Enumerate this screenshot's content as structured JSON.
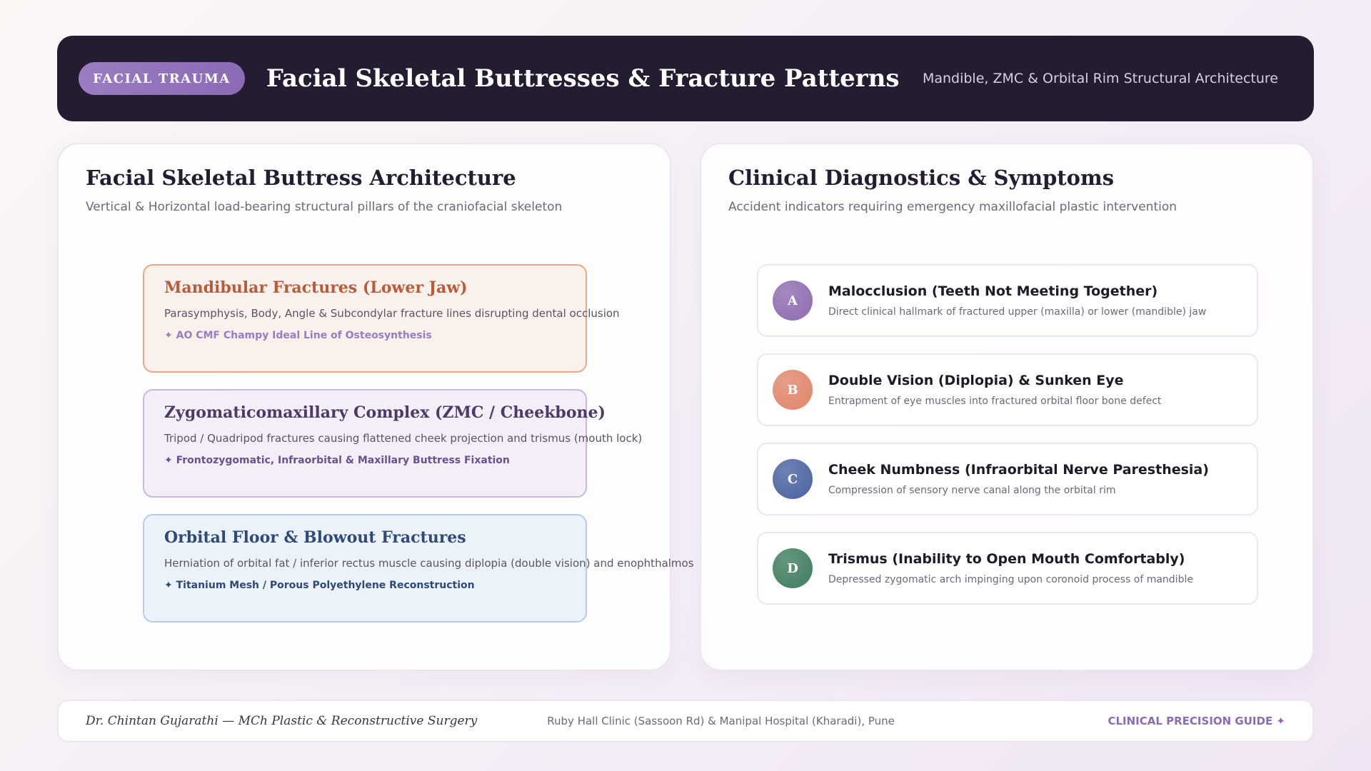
{
  "header": {
    "badge": "FACIAL TRAUMA",
    "title": "Facial Skeletal Buttresses & Fracture Patterns",
    "subtitle": "Mandible, ZMC & Orbital Rim Structural Architecture"
  },
  "left_panel": {
    "title": "Facial Skeletal Buttress Architecture",
    "subtitle": "Vertical & Horizontal load-bearing structural pillars of the craniofacial skeleton",
    "cards": [
      {
        "title": "Mandibular Fractures (Lower Jaw)",
        "description": "Parasymphysis, Body, Angle & Subcondylar fracture lines disrupting dental occlusion",
        "note": "✦ AO CMF Champy Ideal Line of Osteosynthesis"
      },
      {
        "title": "Zygomaticomaxillary Complex (ZMC / Cheekbone)",
        "description": "Tripod / Quadripod fractures causing flattened cheek projection and trismus (mouth lock)",
        "note": "✦ Frontozygomatic, Infraorbital & Maxillary Buttress Fixation"
      },
      {
        "title": "Orbital Floor & Blowout Fractures",
        "description": "Herniation of orbital fat / inferior rectus muscle causing diplopia (double vision) and enophthalmos",
        "note": "✦ Titanium Mesh / Porous Polyethylene Reconstruction"
      }
    ]
  },
  "right_panel": {
    "title": "Clinical Diagnostics & Symptoms",
    "subtitle": "Accident indicators requiring emergency maxillofacial plastic intervention",
    "items": [
      {
        "letter": "A",
        "color": "#8e6bb0",
        "title": "Malocclusion (Teeth Not Meeting Together)",
        "description": "Direct clinical hallmark of fractured upper (maxilla) or lower (mandible) jaw"
      },
      {
        "letter": "B",
        "color": "#e0856a",
        "title": "Double Vision (Diplopia) & Sunken Eye",
        "description": "Entrapment of eye muscles into fractured orbital floor bone defect"
      },
      {
        "letter": "C",
        "color": "#4a62a0",
        "title": "Cheek Numbness (Infraorbital Nerve Paresthesia)",
        "description": "Compression of sensory nerve canal along the orbital rim"
      },
      {
        "letter": "D",
        "color": "#3e7d5e",
        "title": "Trismus (Inability to Open Mouth Comfortably)",
        "description": "Depressed zygomatic arch impinging upon coronoid process of mandible"
      }
    ]
  },
  "footer": {
    "doctor": "Dr. Chintan Gujarathi — MCh Plastic & Reconstructive Surgery",
    "location": "Ruby Hall Clinic (Sassoon Rd) & Manipal Hospital (Kharadi), Pune",
    "guide": "CLINICAL PRECISION GUIDE ✦"
  }
}
